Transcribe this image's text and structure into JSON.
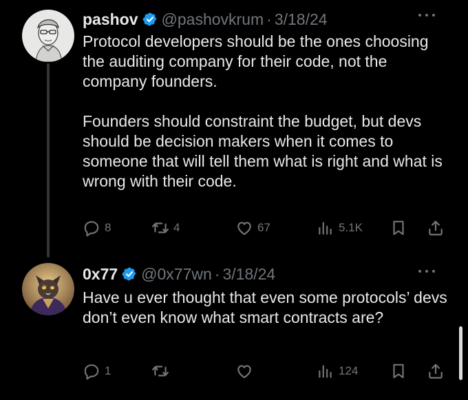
{
  "tweets": [
    {
      "display_name": "pashov",
      "handle": "@pashovkrum",
      "separator": "·",
      "date": "3/18/24",
      "text": "Protocol developers should be the ones choosing the auditing company for their code, not the company founders.\n\nFounders should constraint the budget, but devs should be decision makers when it comes to someone that will tell them what is right and what is wrong with their code.",
      "stats": {
        "replies": "8",
        "reposts": "4",
        "likes": "67",
        "views": "5.1K"
      },
      "avatar": "sketch-portrait-icon"
    },
    {
      "display_name": "0x77",
      "handle": "@0x77wn",
      "separator": "·",
      "date": "3/18/24",
      "text": "Have u ever thought that even some protocols’ devs don’t even know what smart contracts are?",
      "stats": {
        "replies": "1",
        "reposts": "",
        "likes": "",
        "views": "124"
      },
      "avatar": "cat-character-icon"
    }
  ],
  "colors": {
    "background": "#000000",
    "text": "#e7e9ea",
    "secondary": "#71767b",
    "verified": "#1d9bf0",
    "thread_line": "#333639"
  },
  "icons": [
    "verified-badge-icon",
    "more-options-icon",
    "reply-icon",
    "repost-icon",
    "like-icon",
    "views-icon",
    "bookmark-icon",
    "share-icon"
  ]
}
